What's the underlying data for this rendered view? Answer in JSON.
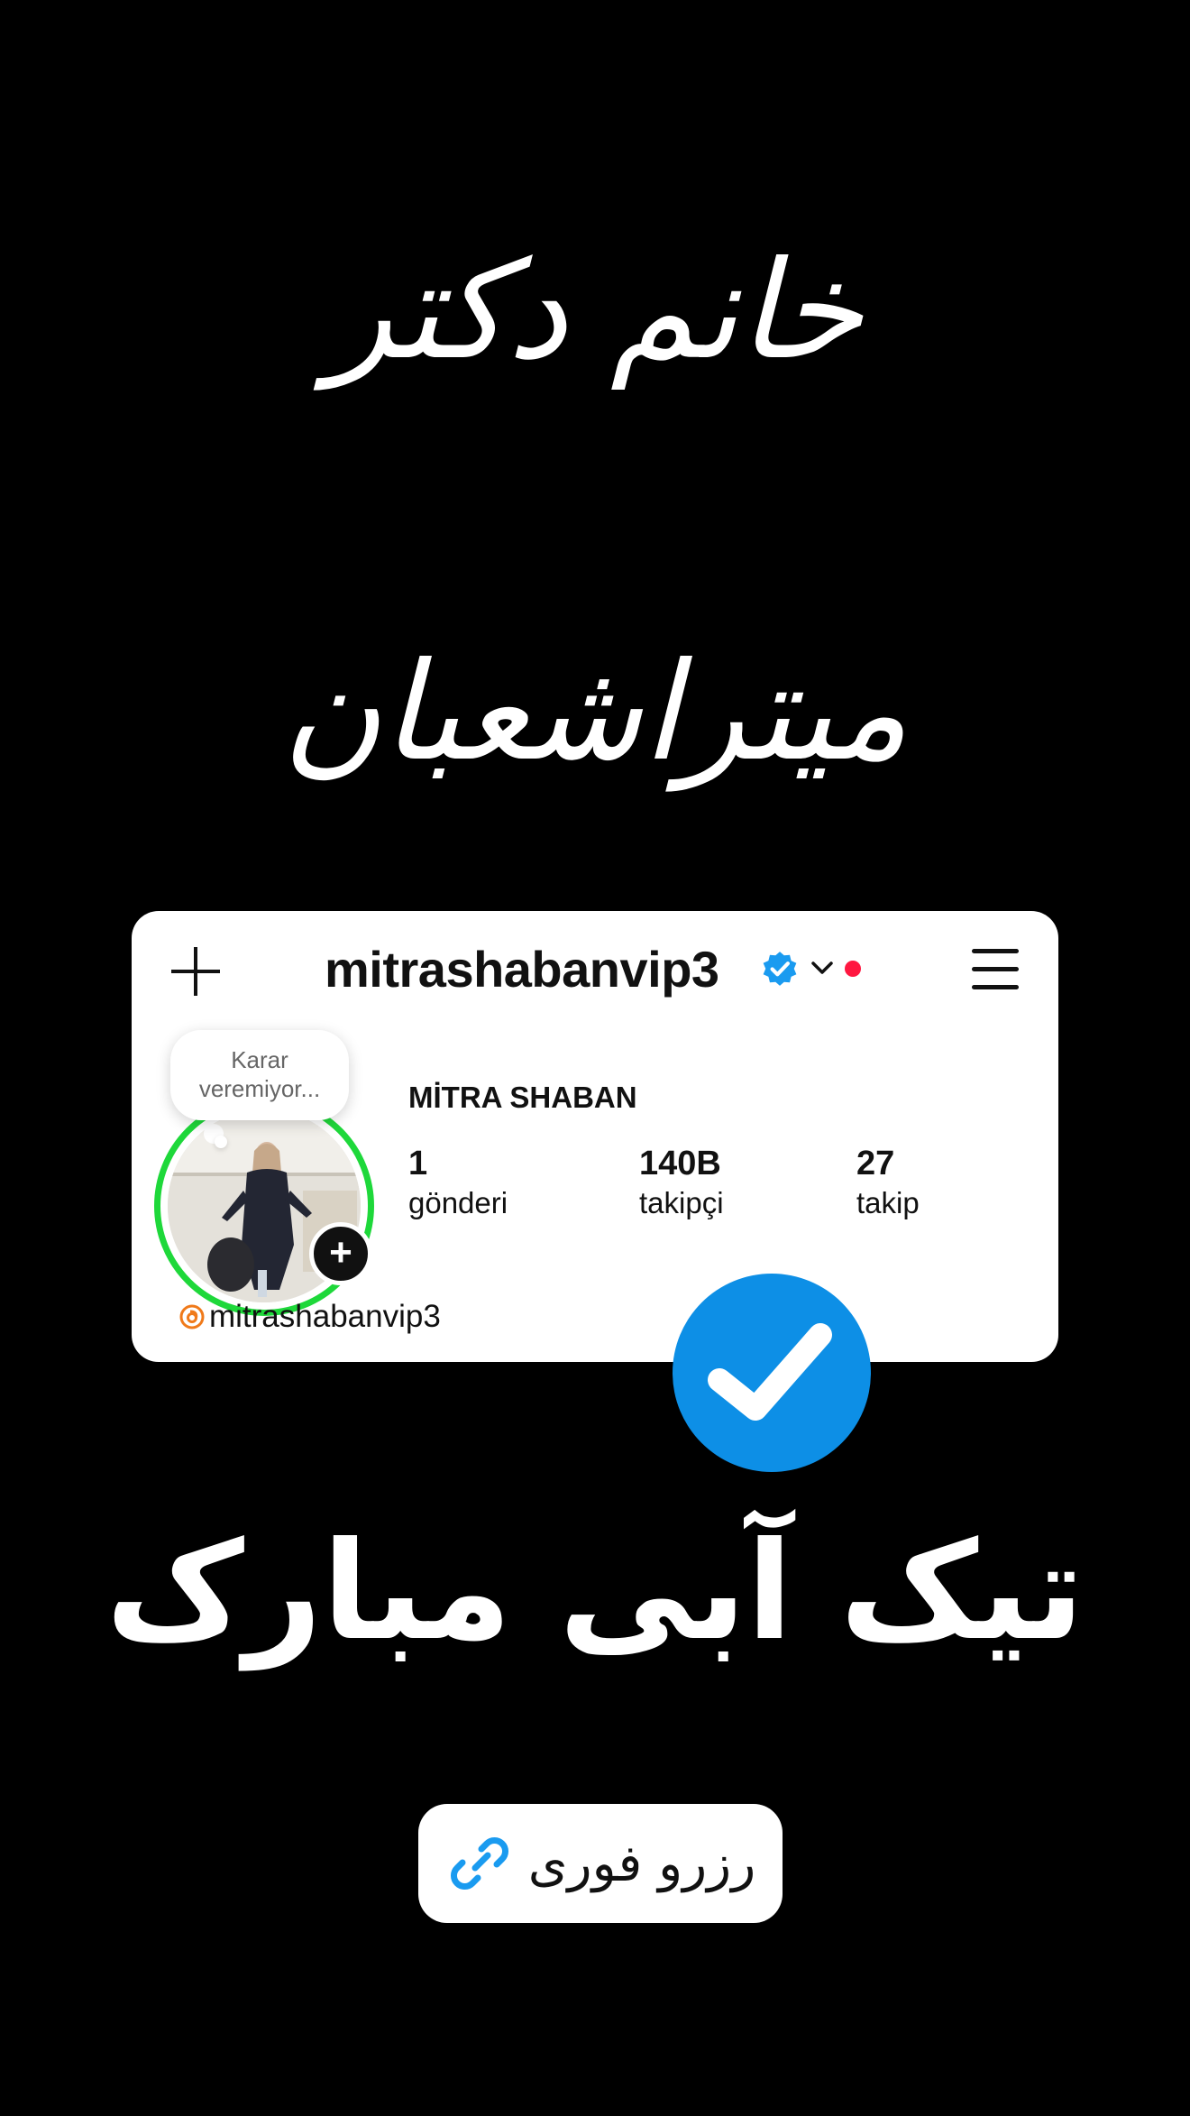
{
  "header": {
    "title_line_1": "خانم دکتر",
    "title_line_2": "میتراشعبان"
  },
  "profile_card": {
    "username": "mitrashabanvip3",
    "note_bubble": [
      "Karar",
      "veremiyor..."
    ],
    "full_name": "MİTRA SHABAN",
    "stats": [
      {
        "value": "1",
        "label": "gönderi"
      },
      {
        "value": "140B",
        "label": "takipçi"
      },
      {
        "value": "27",
        "label": "takip"
      }
    ],
    "threads_handle": "mitrashabanvip3",
    "icons": [
      "plus-icon",
      "verified-badge-icon",
      "chevron-down-icon",
      "notification-dot",
      "hamburger-menu-icon",
      "add-story-icon",
      "threads-icon"
    ]
  },
  "slogan": "تیک آبی مبارک",
  "cta": {
    "label": "رزرو فوری",
    "icon": "link-icon"
  },
  "colors": {
    "background": "#000000",
    "card": "#ffffff",
    "verified_blue": "#0d8fe6",
    "story_ring": "#1ed83a",
    "notification_red": "#ff1740"
  }
}
